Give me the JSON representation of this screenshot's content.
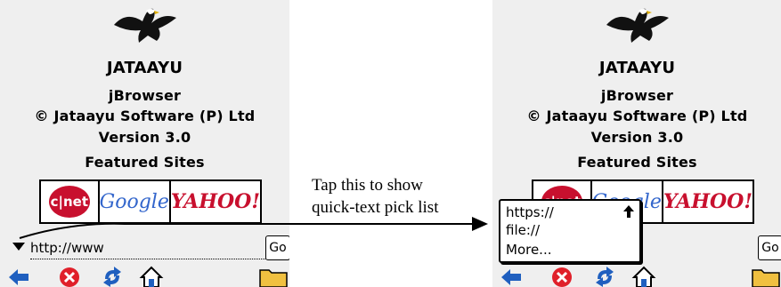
{
  "brand": {
    "title": "JATAAYU",
    "product": "jBrowser",
    "company": "© Jataayu Software (P) Ltd",
    "version": "Version 3.0",
    "featured": "Featured Sites"
  },
  "logos": {
    "cnet": "c|net",
    "google": "Google",
    "yahoo": "YAHOO!"
  },
  "url_bar": {
    "value": "http://www",
    "go_label": "Go"
  },
  "toolbar": {
    "icons": [
      "back-arrow-icon",
      "stop-icon",
      "refresh-icon",
      "home-icon",
      "folder-icon"
    ]
  },
  "picklist": {
    "items": [
      "https://",
      "file://",
      "More..."
    ]
  },
  "callout": {
    "line1": "Tap this to show",
    "line2": "quick-text pick list"
  },
  "colors": {
    "screen_bg": "#efefef",
    "back": "#1f5fbf",
    "stop": "#e0202a",
    "refresh": "#1f5fbf",
    "folder": "#f0c040"
  }
}
